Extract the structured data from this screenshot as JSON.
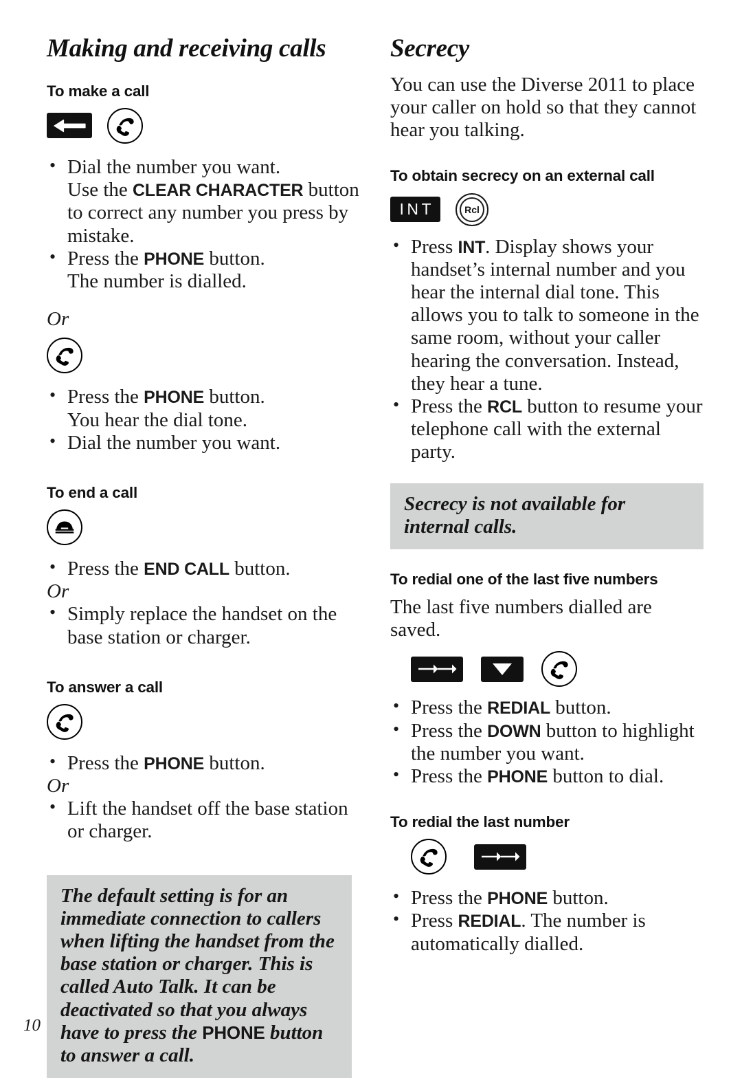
{
  "page": {
    "folio": "10",
    "background": "#ffffff",
    "callout_bg": "#d2d4d4",
    "text_color": "#1a1a1a"
  },
  "left_column": {
    "title": "Making and receiving calls",
    "sections": [
      {
        "heading": "To make a call",
        "icons": [
          "clear-character-key",
          "phone-key"
        ],
        "bullets": [
          {
            "parts": [
              {
                "text": "Dial the number you want. Use the ",
                "bold": false
              },
              {
                "text": "CLEAR CHARACTER",
                "bold": true
              },
              {
                "text": " button to correct any number you press by mistake.",
                "bold": false
              }
            ]
          },
          {
            "parts": [
              {
                "text": "Press the ",
                "bold": false
              },
              {
                "text": "PHONE",
                "bold": true
              },
              {
                "text": " button. The number is dialled.",
                "bold": false
              }
            ]
          }
        ],
        "or_label": "Or",
        "icons_2": [
          "phone-key"
        ],
        "bullets_2": [
          {
            "parts": [
              {
                "text": "Press the ",
                "bold": false
              },
              {
                "text": "PHONE",
                "bold": true
              },
              {
                "text": " button. You hear the dial tone.",
                "bold": false
              }
            ]
          },
          {
            "parts": [
              {
                "text": "Dial the number you want.",
                "bold": false
              }
            ]
          }
        ]
      },
      {
        "heading": "To end a call",
        "icons": [
          "end-call-key"
        ],
        "bullets": [
          {
            "parts": [
              {
                "text": "Press the ",
                "bold": false
              },
              {
                "text": "END CALL",
                "bold": true
              },
              {
                "text": " button.",
                "bold": false
              }
            ]
          }
        ],
        "or_label": "Or",
        "bullets_2": [
          {
            "parts": [
              {
                "text": "Simply replace the handset on the base station or charger.",
                "bold": false
              }
            ]
          }
        ]
      },
      {
        "heading": "To answer a call",
        "icons": [
          "phone-key"
        ],
        "bullets": [
          {
            "parts": [
              {
                "text": "Press the ",
                "bold": false
              },
              {
                "text": "PHONE",
                "bold": true
              },
              {
                "text": " button.",
                "bold": false
              }
            ]
          }
        ],
        "or_label": "Or",
        "bullets_2": [
          {
            "parts": [
              {
                "text": "Lift the handset off the base station or charger.",
                "bold": false
              }
            ]
          }
        ]
      }
    ],
    "callout": {
      "parts": [
        {
          "text": "The default setting is for an immediate connection to callers when lifting the handset from the base station or charger. This is called Auto Talk. It can be deactivated so that you always have to press the ",
          "bold": false
        },
        {
          "text": "PHONE",
          "bold": true
        },
        {
          "text": " button to answer a call.",
          "bold": false
        }
      ]
    }
  },
  "right_column": {
    "title": "Secrecy",
    "intro": "You can use the Diverse 2011 to place your caller on hold so that they cannot hear you talking.",
    "sections": [
      {
        "heading": "To obtain secrecy on an external call",
        "icons": [
          "int-key",
          "rcl-key"
        ],
        "bullets": [
          {
            "parts": [
              {
                "text": "Press ",
                "bold": false
              },
              {
                "text": "INT",
                "bold": true
              },
              {
                "text": ". Display shows your handset’s internal number and you hear the internal dial tone. This allows you to talk to someone in the same room, without your caller hearing the conversation. Instead, they hear a tune.",
                "bold": false
              }
            ]
          },
          {
            "parts": [
              {
                "text": "Press the ",
                "bold": false
              },
              {
                "text": "RCL",
                "bold": true
              },
              {
                "text": " button to resume your telephone call with the external party.",
                "bold": false
              }
            ]
          }
        ]
      },
      {
        "heading": "To redial one of the last five numbers",
        "lead": "The last five numbers dialled are saved.",
        "icons": [
          "redial-key",
          "down-key",
          "phone-key"
        ],
        "bullets": [
          {
            "parts": [
              {
                "text": "Press the ",
                "bold": false
              },
              {
                "text": "REDIAL",
                "bold": true
              },
              {
                "text": " button.",
                "bold": false
              }
            ]
          },
          {
            "parts": [
              {
                "text": "Press the ",
                "bold": false
              },
              {
                "text": "DOWN",
                "bold": true
              },
              {
                "text": " button to highlight the number you want.",
                "bold": false
              }
            ]
          },
          {
            "parts": [
              {
                "text": "Press the ",
                "bold": false
              },
              {
                "text": "PHONE",
                "bold": true
              },
              {
                "text": " button to dial.",
                "bold": false
              }
            ]
          }
        ]
      },
      {
        "heading": "To redial the last number",
        "icons": [
          "phone-key",
          "redial-key"
        ],
        "bullets": [
          {
            "parts": [
              {
                "text": "Press the ",
                "bold": false
              },
              {
                "text": "PHONE",
                "bold": true
              },
              {
                "text": " button.",
                "bold": false
              }
            ]
          },
          {
            "parts": [
              {
                "text": "Press ",
                "bold": false
              },
              {
                "text": "REDIAL",
                "bold": true
              },
              {
                "text": ". The number is automatically dialled.",
                "bold": false
              }
            ]
          }
        ]
      }
    ],
    "callout": {
      "parts": [
        {
          "text": "Secrecy is not available for internal calls.",
          "bold": false
        }
      ]
    },
    "key_labels": {
      "int": "INT",
      "rcl": "Rcl"
    }
  }
}
